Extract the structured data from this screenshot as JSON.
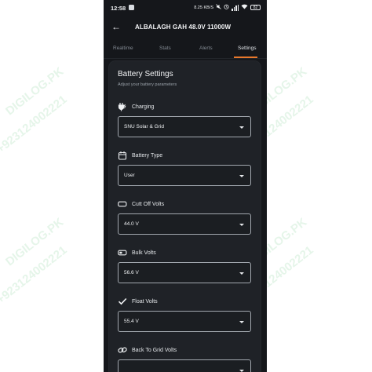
{
  "status_bar": {
    "time": "12:58",
    "speed": "8.25 KB/S",
    "battery": "82"
  },
  "app_bar": {
    "title": "ALBALAGH GAH 48.0V 11000W"
  },
  "tabs": [
    {
      "label": "Realtime",
      "active": false
    },
    {
      "label": "Stats",
      "active": false
    },
    {
      "label": "Alerts",
      "active": false
    },
    {
      "label": "Settings",
      "active": true
    }
  ],
  "card": {
    "title": "Battery Settings",
    "subtitle": "Adjust your battery parameters",
    "fields": [
      {
        "label": "Charging",
        "value": "SNU Solar & Grid",
        "icon": "plug-icon"
      },
      {
        "label": "Battery Type",
        "value": "User",
        "icon": "calendar-icon"
      },
      {
        "label": "Cutt Off Volts",
        "value": "44.0 V",
        "icon": "battery-empty-icon"
      },
      {
        "label": "Bulk Volts",
        "value": "56.6 V",
        "icon": "battery-low-icon"
      },
      {
        "label": "Float Volts",
        "value": "55.4 V",
        "icon": "check-icon"
      },
      {
        "label": "Back To Grid Volts",
        "icon": "link-icon"
      }
    ]
  },
  "watermark": {
    "site": "DIGILOG.PK",
    "phone": "+923124002221"
  },
  "colors": {
    "background": "#15171b",
    "card": "#1f2227",
    "accent": "#e8782c",
    "field_border": "#a2a8af"
  }
}
